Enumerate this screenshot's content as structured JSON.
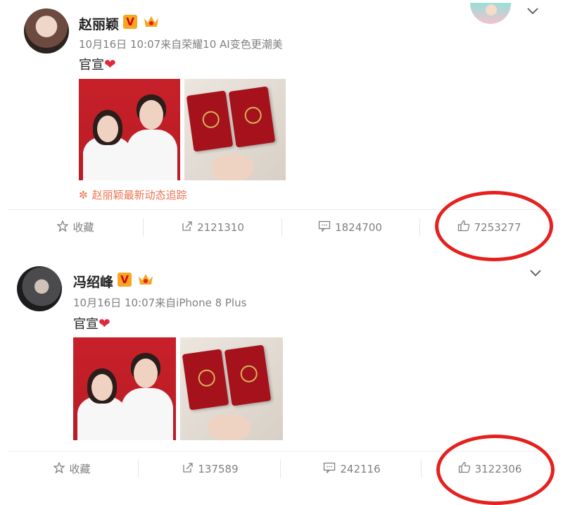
{
  "posts": [
    {
      "author": "赵丽颖",
      "meta": "10月16日 10:07来自荣耀10 AI变色更潮美",
      "content": "官宣",
      "heart_icon": "heart-icon",
      "tracking_link": "赵丽颖最新动态追踪",
      "actions": {
        "favorite": "收藏",
        "repost": "2121310",
        "comment": "1824700",
        "like": "7253277"
      }
    },
    {
      "author": "冯绍峰",
      "meta": "10月16日 10:07来自iPhone 8 Plus",
      "content": "官宣",
      "heart_icon": "heart-icon",
      "actions": {
        "favorite": "收藏",
        "repost": "137589",
        "comment": "242116",
        "like": "3122306"
      }
    }
  ],
  "badges": {
    "verified": "V"
  },
  "colors": {
    "accent": "#eb7350",
    "highlight": "#e5201d",
    "text_muted": "#808080"
  }
}
